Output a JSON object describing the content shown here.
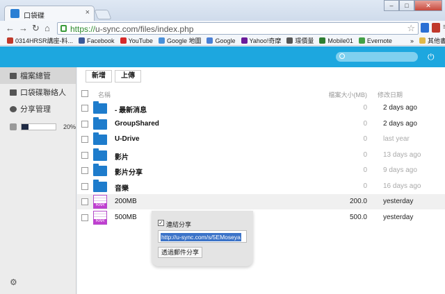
{
  "browser": {
    "tab_title": "口袋碟",
    "url_scheme": "https://",
    "url_rest": "u-sync.com/files/index.php",
    "win_min": "–",
    "win_max": "□",
    "win_close": "✕",
    "bookmarks": [
      {
        "label": "0314HRSR講座-料...",
        "color": "#c0392b"
      },
      {
        "label": "Facebook",
        "color": "#3b5998"
      },
      {
        "label": "YouTube",
        "color": "#d62a2a"
      },
      {
        "label": "Google 地圖",
        "color": "#4a90d9"
      },
      {
        "label": "Google",
        "color": "#4a7fd4"
      },
      {
        "label": "Yahoo!奇摩",
        "color": "#6a1b9a"
      },
      {
        "label": "璟價量",
        "color": "#555555"
      },
      {
        "label": "Mobile01",
        "color": "#2e7d32"
      },
      {
        "label": "Evernote",
        "color": "#43a047"
      }
    ],
    "bookmarks_more": "»",
    "other_bookmarks": "其他書籤"
  },
  "sidebar": {
    "items": [
      {
        "label": "檔案總管",
        "icon": "home-icon"
      },
      {
        "label": "口袋碟聯絡人",
        "icon": "contacts-icon"
      },
      {
        "label": "分享管理",
        "icon": "share-gear-icon"
      }
    ],
    "usage_percent": 20,
    "usage_label": "20%"
  },
  "toolbar": {
    "new_label": "新增",
    "upload_label": "上傳"
  },
  "table": {
    "col_name": "名稱",
    "col_size": "檔案大小(MB)",
    "col_date": "修改日期",
    "rows": [
      {
        "name": "- 最新消息",
        "size": "0",
        "date": "2 days ago",
        "type": "folder"
      },
      {
        "name": "GroupShared",
        "size": "0",
        "date": "2 days ago",
        "type": "folder"
      },
      {
        "name": "U-Drive",
        "size": "0",
        "date": "last year",
        "type": "folder"
      },
      {
        "name": "影片",
        "size": "0",
        "date": "13 days ago",
        "type": "folder"
      },
      {
        "name": "影片分享",
        "size": "0",
        "date": "9 days ago",
        "type": "folder"
      },
      {
        "name": "音樂",
        "size": "0",
        "date": "16 days ago",
        "type": "folder"
      },
      {
        "name": "200MB",
        "size": "200.0",
        "date": "yesterday",
        "type": "rar"
      },
      {
        "name": "500MB",
        "size": "500.0",
        "date": "yesterday",
        "type": "rar"
      }
    ]
  },
  "share_popup": {
    "checkbox_label": "連結分享",
    "link": "http://u-sync.com/s/5EMoseya",
    "email_button": "透過郵件分享"
  }
}
